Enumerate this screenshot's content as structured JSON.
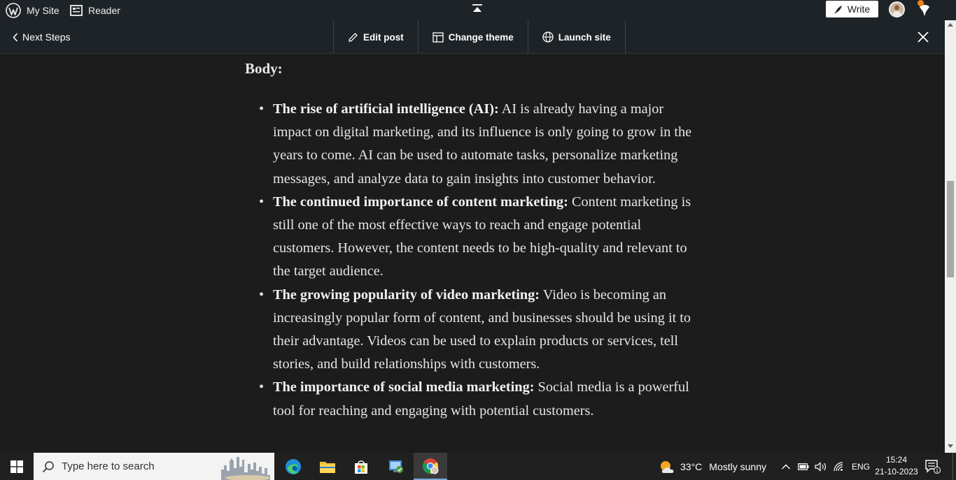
{
  "adminbar": {
    "my_site_label": "My Site",
    "reader_label": "Reader",
    "write_label": "Write"
  },
  "toolbar": {
    "next_steps_label": "Next Steps",
    "edit_post_label": "Edit post",
    "change_theme_label": "Change theme",
    "launch_site_label": "Launch site"
  },
  "content": {
    "heading": "Body:",
    "bullets": [
      {
        "title": "The rise of artificial intelligence (AI):",
        "text": "AI is already having a major impact on digital marketing, and its influence is only going to grow in the years to come. AI can be used to automate tasks, personalize marketing messages, and analyze data to gain insights into customer behavior."
      },
      {
        "title": "The continued importance of content marketing:",
        "text": "Content marketing is still one of the most effective ways to reach and engage potential customers. However, the content needs to be high-quality and relevant to the target audience."
      },
      {
        "title": "The growing popularity of video marketing:",
        "text": "Video is becoming an increasingly popular form of content, and businesses should be using it to their advantage. Videos can be used to explain products or services, tell stories, and build relationships with customers."
      },
      {
        "title": "The importance of social media marketing:",
        "text": "Social media is a powerful tool for reaching and engaging with potential customers."
      }
    ]
  },
  "taskbar": {
    "search_placeholder": "Type here to search",
    "weather_temp": "33°C",
    "weather_desc": "Mostly sunny",
    "language": "ENG",
    "time": "15:24",
    "date": "21-10-2023",
    "notification_count": "1"
  },
  "colors": {
    "adminbar_bg": "#1e2327",
    "content_bg": "#1c1c1c",
    "taskbar_bg": "#202020",
    "notification_dot": "#f0821e"
  }
}
